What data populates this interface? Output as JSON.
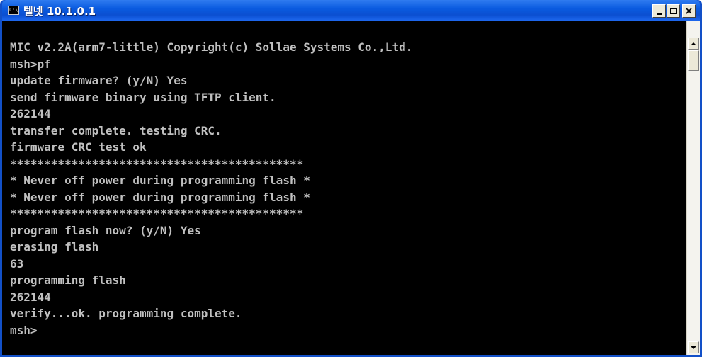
{
  "window": {
    "title": "텔넷 10.1.0.1",
    "icon": "console-window-icon",
    "icon_text": "C:\\"
  },
  "controls": {
    "minimize_icon": "minimize-icon",
    "maximize_icon": "maximize-icon",
    "close_icon": "close-icon",
    "close_glyph": "×"
  },
  "console": {
    "lines": [
      "MIC v2.2A(arm7-little) Copyright(c) Sollae Systems Co.,Ltd.",
      "msh>pf",
      "update firmware? (y/N) Yes",
      "send firmware binary using TFTP client.",
      "262144",
      "transfer complete. testing CRC.",
      "firmware CRC test ok",
      "*******************************************",
      "* Never off power during programming flash *",
      "* Never off power during programming flash *",
      "*******************************************",
      "program flash now? (y/N) Yes",
      "erasing flash",
      "63",
      "programming flash",
      "262144",
      "verify...ok. programming complete.",
      "msh>"
    ],
    "text_color": "#c0c0c0",
    "background_color": "#000000"
  },
  "colors": {
    "titlebar_accent": "#0b4fd1"
  }
}
